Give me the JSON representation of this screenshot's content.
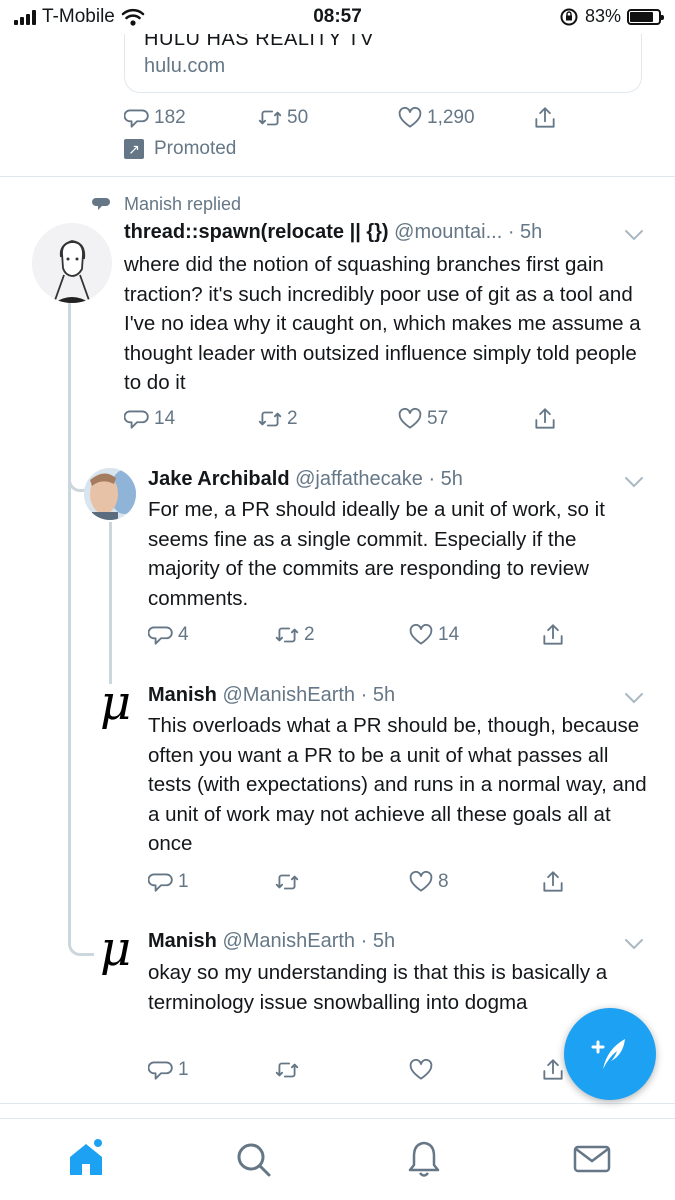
{
  "status_bar": {
    "carrier": "T-Mobile",
    "time": "08:57",
    "battery_pct": "83%",
    "battery_level": 0.83
  },
  "promoted_card": {
    "headline": "HULU HAS REALITY TV",
    "domain": "hulu.com",
    "reply_count": "182",
    "retweet_count": "50",
    "like_count": "1,290",
    "promoted_label": "Promoted"
  },
  "thread": {
    "context_label": "Manish replied",
    "tweets": [
      {
        "name": "thread::spawn(relocate || {})",
        "meta": "@mountai... · 5h",
        "text": "where did the notion of squashing branches first gain traction? it's such incredibly poor use of git as a tool and I've no idea why it caught on, which makes me assume a thought leader with outsized influence simply told people to do it",
        "replies": "14",
        "retweets": "2",
        "likes": "57"
      },
      {
        "name": "Jake Archibald",
        "meta": "@jaffathecake · 5h",
        "text": "For me, a PR should ideally be a unit of work, so it seems fine as a single commit. Especially if the majority of the commits are responding to review comments.",
        "replies": "4",
        "retweets": "2",
        "likes": "14"
      },
      {
        "name": "Manish",
        "meta": "@ManishEarth · 5h",
        "text": "This overloads what a PR should be, though, because often you want a PR to be a unit of what passes all tests (with expectations) and runs in a normal way, and a unit of work may not achieve all these goals all at once",
        "replies": "1",
        "retweets": "",
        "likes": "8"
      },
      {
        "name": "Manish",
        "meta": "@ManishEarth · 5h",
        "text": "okay so my understanding is that this is basically a terminology issue snowballing into dogma",
        "replies": "1",
        "retweets": "",
        "likes": ""
      }
    ]
  },
  "avatar_glyph": "μ",
  "tabs": [
    "home-icon",
    "search-icon",
    "notifications-icon",
    "messages-icon"
  ],
  "colors": {
    "accent": "#1da1f2",
    "muted": "#657786",
    "thread_line": "#ccd6dd",
    "divider": "#e1e8ed"
  }
}
